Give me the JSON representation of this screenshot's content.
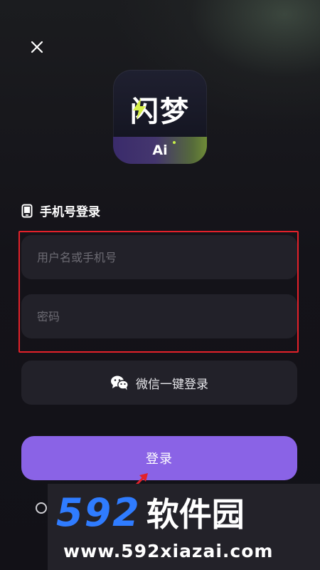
{
  "header": {
    "close_icon": "close-icon"
  },
  "app_icon": {
    "title": "闪梦",
    "badge": "Ai",
    "colors": {
      "accent_purple": "#3a2b6b",
      "accent_green": "#6f8c37",
      "bolt": "#d7f04a"
    }
  },
  "login": {
    "heading": "手机号登录",
    "heading_icon": "phone-icon",
    "username_placeholder": "用户名或手机号",
    "password_placeholder": "密码",
    "wechat_label": "微信一键登录",
    "wechat_icon": "wechat-icon",
    "submit_label": "登录",
    "highlight_color": "#e3212a",
    "button_color": "#8a63e6"
  },
  "watermark": {
    "brand_number": "592",
    "brand_text": "软件园",
    "site": "www.592xiazai.com",
    "brand_color": "#2f7cff"
  }
}
